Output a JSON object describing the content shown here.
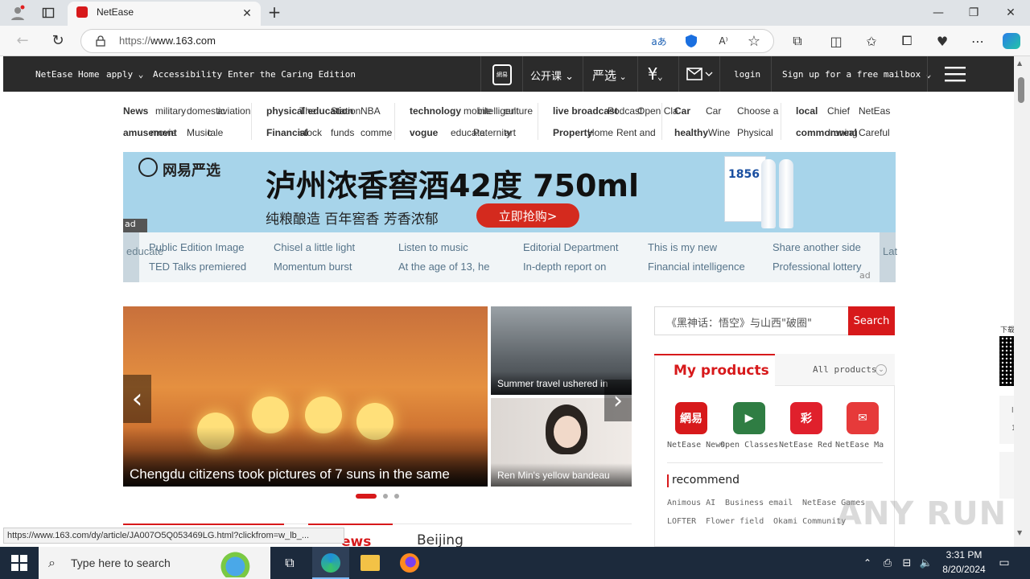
{
  "browser": {
    "tab_title": "NetEase",
    "new_tab": "+",
    "url_prefix": "https://",
    "url_host": "www.163.com",
    "translate_icon": "aあ",
    "read_aloud_icon": "A⁾",
    "status_url": "https://www.163.com/dy/article/JA007O5Q053469LG.html?clickfrom=w_lb_..."
  },
  "topbar": {
    "home": "NetEase Home",
    "apply": "apply",
    "accessibility": "Accessibility",
    "caring": "Enter the Caring Edition",
    "open_course": "公开课",
    "yanxuan": "严选",
    "login": "login",
    "signup": "Sign up for a free mailbox",
    "news_app": "網易"
  },
  "nav": {
    "rows": [
      [
        {
          "head": "News",
          "items": [
            "military",
            "domestic",
            "aviation"
          ]
        },
        {
          "head": "physical education",
          "items": [
            "The",
            "Station",
            "NBA"
          ]
        },
        {
          "head": "technology",
          "items": [
            "mobile",
            "intelligent",
            "culture"
          ]
        },
        {
          "head": "live broadcast",
          "items": [
            "Podcast",
            "Open Cla"
          ]
        },
        {
          "head": "Car",
          "items": [
            "Car",
            "Choose a"
          ]
        },
        {
          "head": "local",
          "items": [
            "Chief",
            "NetEas"
          ]
        }
      ],
      [
        {
          "head": "amusement",
          "items": [
            "movie",
            "Music",
            "tale"
          ]
        },
        {
          "head": "Financial",
          "items": [
            "stock",
            "funds",
            "comme"
          ]
        },
        {
          "head": "vogue",
          "items": [
            "educate",
            "Paternity",
            "art"
          ]
        },
        {
          "head": "Property",
          "items": [
            "Home",
            "Rent and"
          ]
        },
        {
          "head": "healthy",
          "items": [
            "Wine",
            "Physical"
          ]
        },
        {
          "head": "commonweal",
          "items": [
            "Ironing",
            "Careful"
          ]
        }
      ]
    ]
  },
  "ad": {
    "logo": "网易严选",
    "headline": "泸州浓香窖酒42度 750ml",
    "subline": "纯粮酿造 百年窖香 芳香浓郁",
    "button": "立即抢购>",
    "label": "ad",
    "bottle_label": "1856"
  },
  "links": {
    "left_tab": "educate",
    "right_tab": "Lat",
    "ad_label": "ad",
    "row1": [
      "Public Edition Image",
      "Chisel a little light",
      "Listen to music",
      "Editorial Department",
      "This is my new",
      "Share another side"
    ],
    "row2": [
      "TED Talks premiered",
      "Momentum burst",
      "At the age of 13, he",
      "In-depth report on",
      "Financial intelligence",
      "Professional lottery"
    ]
  },
  "carousel": {
    "main_caption": "Chengdu citizens took pictures of 7 suns in the same",
    "thumb1_caption": "Summer travel ushered in",
    "thumb2_caption": "Ren Min's yellow bandeau",
    "prev": "‹",
    "next": "›"
  },
  "search": {
    "placeholder": "《黑神话：悟空》与山西\"破圈\"",
    "button": "Search"
  },
  "products": {
    "title": "My products",
    "all": "All products",
    "apps": [
      {
        "label": "NetEase News",
        "glyph": "網易",
        "color": "#d7191b"
      },
      {
        "label": "Open Classes",
        "glyph": "▶",
        "color": "#2f7d43"
      },
      {
        "label": "NetEase Red",
        "glyph": "彩",
        "color": "#e0202c"
      },
      {
        "label": "NetEase Ma",
        "glyph": "✉",
        "color": "#e63a3a"
      }
    ],
    "recommend_title": "recommend",
    "recommend_row1": [
      "Animous AI",
      "Business email",
      "NetEase Games"
    ],
    "recommend_row2": [
      "LOFTER",
      "Flower field",
      "Okami Community"
    ]
  },
  "bottom_tabs": {
    "news": "ews",
    "beijing": "Beijing"
  },
  "side": {
    "download": "下载",
    "side_a": "l",
    "side_b": "1"
  },
  "taskbar": {
    "search_placeholder": "Type here to search",
    "time": "3:31 PM",
    "date": "8/20/2024"
  },
  "watermark": "ANY RUN"
}
